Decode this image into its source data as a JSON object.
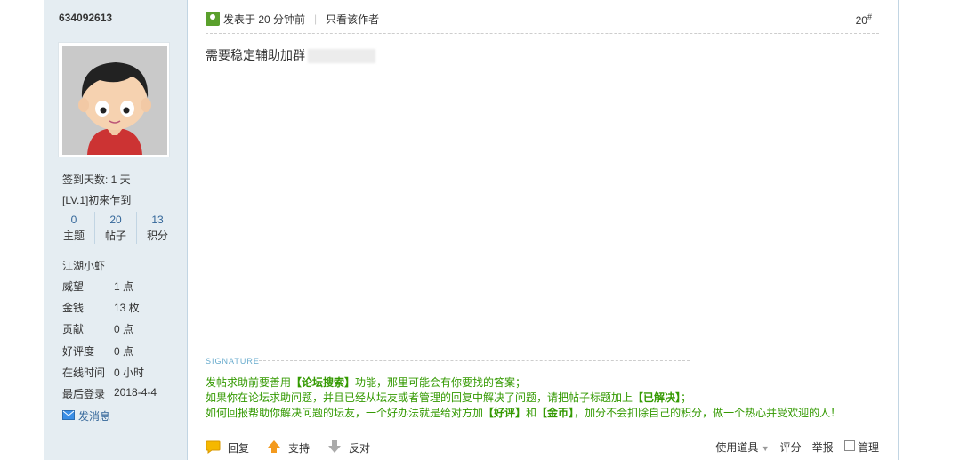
{
  "sidebar": {
    "username": "634092613",
    "checkin": "签到天数: 1 天",
    "level": "[LV.1]初来乍到",
    "stats": [
      {
        "value": "0",
        "label": "主题"
      },
      {
        "value": "20",
        "label": "帖子"
      },
      {
        "value": "13",
        "label": "积分"
      }
    ],
    "rank": "江湖小虾",
    "info": [
      {
        "label": "威望",
        "value": "1 点"
      },
      {
        "label": "金钱",
        "value": "13 枚"
      },
      {
        "label": "贡献",
        "value": "0 点"
      },
      {
        "label": "好评度",
        "value": "0 点"
      },
      {
        "label": "在线时间",
        "value": "0 小时"
      },
      {
        "label": "最后登录",
        "value": "2018-4-4"
      }
    ],
    "pm_label": "发消息"
  },
  "post": {
    "posted_at": "发表于 20 分钟前",
    "author_only": "只看该作者",
    "floor": "20",
    "floor_sup": "#",
    "content": "需要稳定辅助加群"
  },
  "signature": {
    "label": "SIGNATURE",
    "line1_a": "发帖求助前要善用",
    "line1_b": "【论坛搜索】",
    "line1_c": "功能，那里可能会有你要找的答案；",
    "line2_a": "如果你在论坛求助问题，并且已经从坛友或者管理的回复中解决了问题，请把帖子标题加上",
    "line2_b": "【已解决】",
    "line2_c": "；",
    "line3_a": "如何回报帮助你解决问题的坛友，一个好办法就是给对方加",
    "line3_b": "【好评】",
    "line3_c": "和",
    "line3_d": "【金币】",
    "line3_e": "，加分不会扣除自己的积分，做一个热心并受欢迎的人！"
  },
  "actions": {
    "reply": "回复",
    "support": "支持",
    "oppose": "反对"
  },
  "tools": {
    "use_tools": "使用道具",
    "rate": "评分",
    "report": "举报",
    "manage": "管理"
  }
}
